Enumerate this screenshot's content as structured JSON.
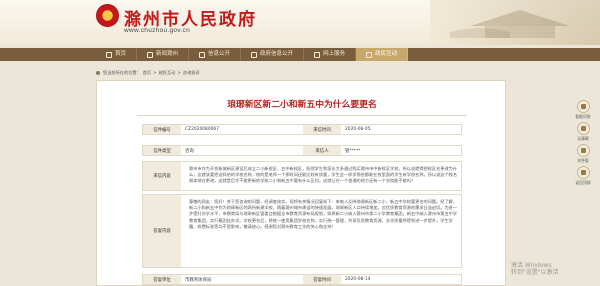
{
  "header": {
    "site_title": "滁州市人民政府",
    "site_url": "www.chuzhou.gov.cn",
    "emblem_glyph": "☆"
  },
  "nav": {
    "items": [
      {
        "label": "首页",
        "icon": "home-icon"
      },
      {
        "label": "新闻滁州",
        "icon": "news-icon"
      },
      {
        "label": "信息公开",
        "icon": "info-icon"
      },
      {
        "label": "政府信息公开",
        "icon": "doc-icon"
      },
      {
        "label": "网上服务",
        "icon": "service-icon"
      },
      {
        "label": "政民互动",
        "icon": "chat-icon",
        "active": true
      }
    ]
  },
  "breadcrumb": {
    "items": [
      "您当前所在的位置：",
      "首页",
      ">",
      "政民互动",
      ">",
      "咨询投诉"
    ]
  },
  "article": {
    "title": "琅琊新区新二小和新五中为什么要更名",
    "rows": [
      {
        "label1": "信件编号",
        "value1": "CZ2020080067",
        "label2": "来信时间",
        "value2": "2020-08-05"
      },
      {
        "label1": "信件类型",
        "value1": "咨询",
        "label2": "来信人",
        "value2": "管*****"
      }
    ],
    "question_label": "来信内容",
    "question_text": "滁州市作为开发新城新区建设后成立二小新校区、五中新校区，既然学生和家长大多通过购买滁州市中新校区学校，所以说就得把校区名更改为什么，这就该要把这样给的学校名称，校的是老师一个那时间还能比较有质量，学生会一样学那些都能在校里面的学生有学校名称，所以说这个校名根本地在更改，这就是后才不能更新的学校二小和新五中要有什么区别，这就让在一个普通的地方还有一个学校能不能吗？",
    "answer_label": "答复内容",
    "answer_text": "尊敬的网友：您好！关于您咨询的问题，经调查核实，现将有关情况回复如下：来电人反映琅琊新区新二小、新五中学校要更名的问题。经了解，新二小和新五中作为琅琊新区的两所新建学校，随着滁州城市建设的快速发展，琅琊新区人口持续增加，对优质教育资源的需求日益迫切。为进一步提升办学水平，市教育局与琅琊新区管委会根据全市教育资源布局规划，拟将新二小纳入滁州市第二小学教育集团，新五中纳入滁州市第五中学教育集团，实行集团化办学。学校更名后，将统一使用集团学校名称，实行统一管理，共享优质教育资源，办学质量将得到进一步提升。学生学籍、收费标准等均不受影响，敬请放心。感谢您对滁州教育工作的关心和支持！",
    "reply_org_label": "答复单位",
    "reply_org_value": "市教育体育局",
    "reply_time_label": "答复时间",
    "reply_time_value": "2020-08-14"
  },
  "right_tools": [
    {
      "label": "智能问答",
      "icon": "qa-icon"
    },
    {
      "label": "无障碍",
      "icon": "accessibility-icon"
    },
    {
      "label": "关怀版",
      "icon": "care-icon"
    },
    {
      "label": "返回顶部",
      "icon": "top-icon"
    }
  ],
  "watermark": {
    "line1": "激活 Windows",
    "line2": "转到\"设置\"以激活"
  }
}
